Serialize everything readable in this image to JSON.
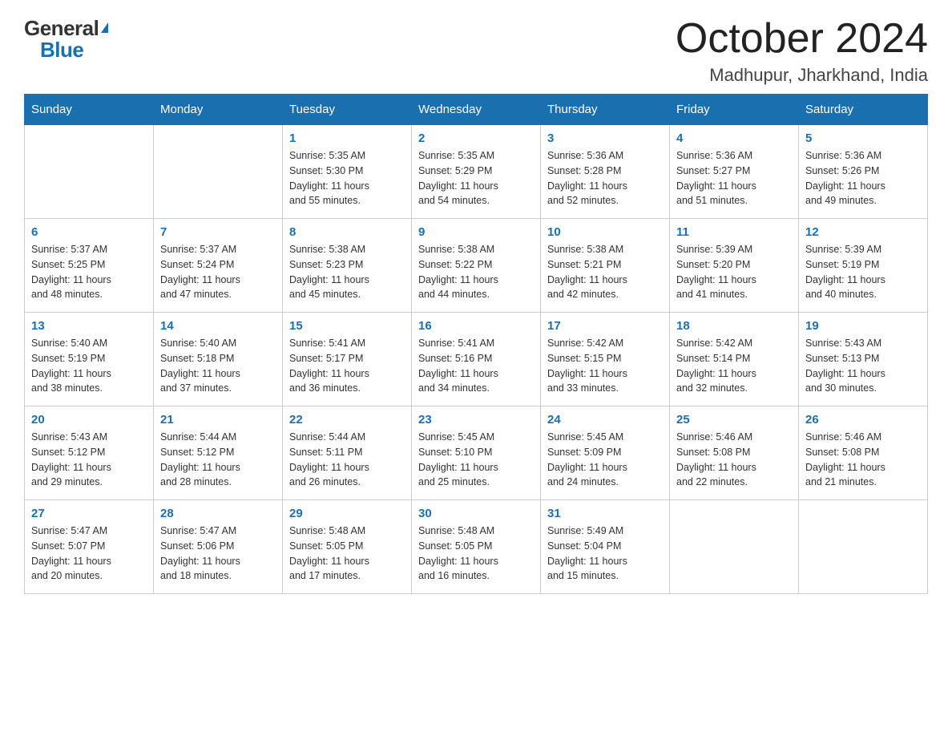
{
  "logo": {
    "general": "General",
    "blue": "Blue",
    "triangle_char": "▶"
  },
  "title": "October 2024",
  "location": "Madhupur, Jharkhand, India",
  "weekdays": [
    "Sunday",
    "Monday",
    "Tuesday",
    "Wednesday",
    "Thursday",
    "Friday",
    "Saturday"
  ],
  "weeks": [
    [
      {
        "day": "",
        "sunrise": "",
        "sunset": "",
        "daylight": ""
      },
      {
        "day": "",
        "sunrise": "",
        "sunset": "",
        "daylight": ""
      },
      {
        "day": "1",
        "sunrise": "Sunrise: 5:35 AM",
        "sunset": "Sunset: 5:30 PM",
        "daylight": "Daylight: 11 hours and 55 minutes."
      },
      {
        "day": "2",
        "sunrise": "Sunrise: 5:35 AM",
        "sunset": "Sunset: 5:29 PM",
        "daylight": "Daylight: 11 hours and 54 minutes."
      },
      {
        "day": "3",
        "sunrise": "Sunrise: 5:36 AM",
        "sunset": "Sunset: 5:28 PM",
        "daylight": "Daylight: 11 hours and 52 minutes."
      },
      {
        "day": "4",
        "sunrise": "Sunrise: 5:36 AM",
        "sunset": "Sunset: 5:27 PM",
        "daylight": "Daylight: 11 hours and 51 minutes."
      },
      {
        "day": "5",
        "sunrise": "Sunrise: 5:36 AM",
        "sunset": "Sunset: 5:26 PM",
        "daylight": "Daylight: 11 hours and 49 minutes."
      }
    ],
    [
      {
        "day": "6",
        "sunrise": "Sunrise: 5:37 AM",
        "sunset": "Sunset: 5:25 PM",
        "daylight": "Daylight: 11 hours and 48 minutes."
      },
      {
        "day": "7",
        "sunrise": "Sunrise: 5:37 AM",
        "sunset": "Sunset: 5:24 PM",
        "daylight": "Daylight: 11 hours and 47 minutes."
      },
      {
        "day": "8",
        "sunrise": "Sunrise: 5:38 AM",
        "sunset": "Sunset: 5:23 PM",
        "daylight": "Daylight: 11 hours and 45 minutes."
      },
      {
        "day": "9",
        "sunrise": "Sunrise: 5:38 AM",
        "sunset": "Sunset: 5:22 PM",
        "daylight": "Daylight: 11 hours and 44 minutes."
      },
      {
        "day": "10",
        "sunrise": "Sunrise: 5:38 AM",
        "sunset": "Sunset: 5:21 PM",
        "daylight": "Daylight: 11 hours and 42 minutes."
      },
      {
        "day": "11",
        "sunrise": "Sunrise: 5:39 AM",
        "sunset": "Sunset: 5:20 PM",
        "daylight": "Daylight: 11 hours and 41 minutes."
      },
      {
        "day": "12",
        "sunrise": "Sunrise: 5:39 AM",
        "sunset": "Sunset: 5:19 PM",
        "daylight": "Daylight: 11 hours and 40 minutes."
      }
    ],
    [
      {
        "day": "13",
        "sunrise": "Sunrise: 5:40 AM",
        "sunset": "Sunset: 5:19 PM",
        "daylight": "Daylight: 11 hours and 38 minutes."
      },
      {
        "day": "14",
        "sunrise": "Sunrise: 5:40 AM",
        "sunset": "Sunset: 5:18 PM",
        "daylight": "Daylight: 11 hours and 37 minutes."
      },
      {
        "day": "15",
        "sunrise": "Sunrise: 5:41 AM",
        "sunset": "Sunset: 5:17 PM",
        "daylight": "Daylight: 11 hours and 36 minutes."
      },
      {
        "day": "16",
        "sunrise": "Sunrise: 5:41 AM",
        "sunset": "Sunset: 5:16 PM",
        "daylight": "Daylight: 11 hours and 34 minutes."
      },
      {
        "day": "17",
        "sunrise": "Sunrise: 5:42 AM",
        "sunset": "Sunset: 5:15 PM",
        "daylight": "Daylight: 11 hours and 33 minutes."
      },
      {
        "day": "18",
        "sunrise": "Sunrise: 5:42 AM",
        "sunset": "Sunset: 5:14 PM",
        "daylight": "Daylight: 11 hours and 32 minutes."
      },
      {
        "day": "19",
        "sunrise": "Sunrise: 5:43 AM",
        "sunset": "Sunset: 5:13 PM",
        "daylight": "Daylight: 11 hours and 30 minutes."
      }
    ],
    [
      {
        "day": "20",
        "sunrise": "Sunrise: 5:43 AM",
        "sunset": "Sunset: 5:12 PM",
        "daylight": "Daylight: 11 hours and 29 minutes."
      },
      {
        "day": "21",
        "sunrise": "Sunrise: 5:44 AM",
        "sunset": "Sunset: 5:12 PM",
        "daylight": "Daylight: 11 hours and 28 minutes."
      },
      {
        "day": "22",
        "sunrise": "Sunrise: 5:44 AM",
        "sunset": "Sunset: 5:11 PM",
        "daylight": "Daylight: 11 hours and 26 minutes."
      },
      {
        "day": "23",
        "sunrise": "Sunrise: 5:45 AM",
        "sunset": "Sunset: 5:10 PM",
        "daylight": "Daylight: 11 hours and 25 minutes."
      },
      {
        "day": "24",
        "sunrise": "Sunrise: 5:45 AM",
        "sunset": "Sunset: 5:09 PM",
        "daylight": "Daylight: 11 hours and 24 minutes."
      },
      {
        "day": "25",
        "sunrise": "Sunrise: 5:46 AM",
        "sunset": "Sunset: 5:08 PM",
        "daylight": "Daylight: 11 hours and 22 minutes."
      },
      {
        "day": "26",
        "sunrise": "Sunrise: 5:46 AM",
        "sunset": "Sunset: 5:08 PM",
        "daylight": "Daylight: 11 hours and 21 minutes."
      }
    ],
    [
      {
        "day": "27",
        "sunrise": "Sunrise: 5:47 AM",
        "sunset": "Sunset: 5:07 PM",
        "daylight": "Daylight: 11 hours and 20 minutes."
      },
      {
        "day": "28",
        "sunrise": "Sunrise: 5:47 AM",
        "sunset": "Sunset: 5:06 PM",
        "daylight": "Daylight: 11 hours and 18 minutes."
      },
      {
        "day": "29",
        "sunrise": "Sunrise: 5:48 AM",
        "sunset": "Sunset: 5:05 PM",
        "daylight": "Daylight: 11 hours and 17 minutes."
      },
      {
        "day": "30",
        "sunrise": "Sunrise: 5:48 AM",
        "sunset": "Sunset: 5:05 PM",
        "daylight": "Daylight: 11 hours and 16 minutes."
      },
      {
        "day": "31",
        "sunrise": "Sunrise: 5:49 AM",
        "sunset": "Sunset: 5:04 PM",
        "daylight": "Daylight: 11 hours and 15 minutes."
      },
      {
        "day": "",
        "sunrise": "",
        "sunset": "",
        "daylight": ""
      },
      {
        "day": "",
        "sunrise": "",
        "sunset": "",
        "daylight": ""
      }
    ]
  ]
}
